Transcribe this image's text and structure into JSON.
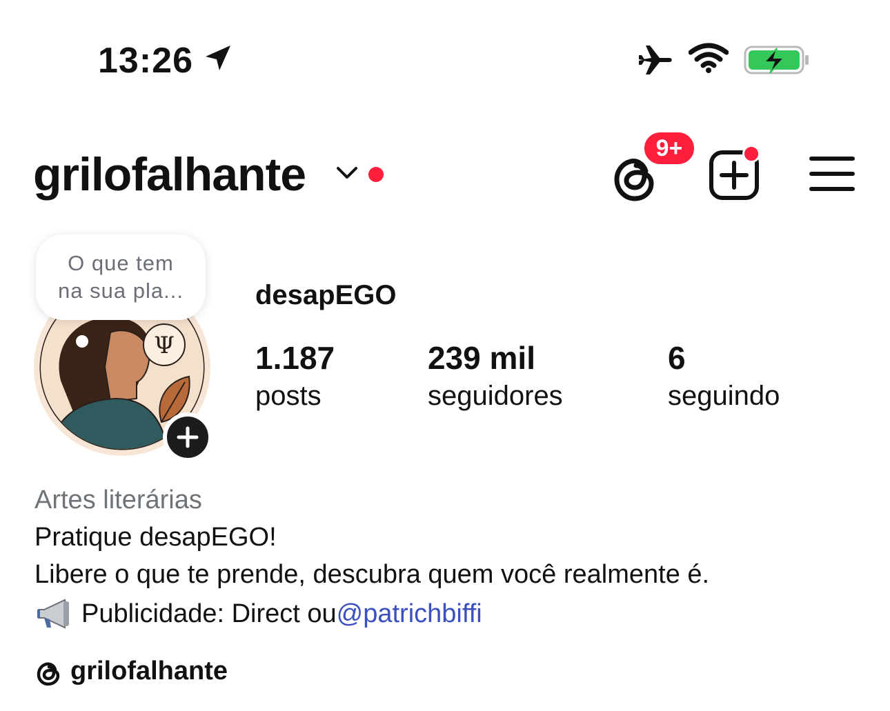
{
  "status_bar": {
    "time": "13:26",
    "icons": [
      "location-arrow-icon",
      "airplane-icon",
      "wifi-icon",
      "battery-charging-icon"
    ],
    "battery_color": "#34c759"
  },
  "header": {
    "username": "grilofalhante",
    "threads_badge": "9+",
    "notification_color": "#ff1f3d"
  },
  "note": {
    "line1": "O que tem",
    "line2": "na sua pla..."
  },
  "profile": {
    "display_name": "desapEGO",
    "stats": [
      {
        "value": "1.187",
        "label": "posts"
      },
      {
        "value": "239 mil",
        "label": "seguidores"
      },
      {
        "value": "6",
        "label": "seguindo"
      }
    ]
  },
  "bio": {
    "category": "Artes literárias",
    "line1": "Pratique desapEGO!",
    "line2": "Libere o que te prende, descubra quem você realmente é.",
    "line3_text": "Publicidade: Direct ou ",
    "line3_mention": "@patrichbiffi"
  },
  "threads_link": {
    "label": "grilofalhante"
  },
  "colors": {
    "mention": "#3b4fbf",
    "secondary_text": "#6e7378"
  }
}
